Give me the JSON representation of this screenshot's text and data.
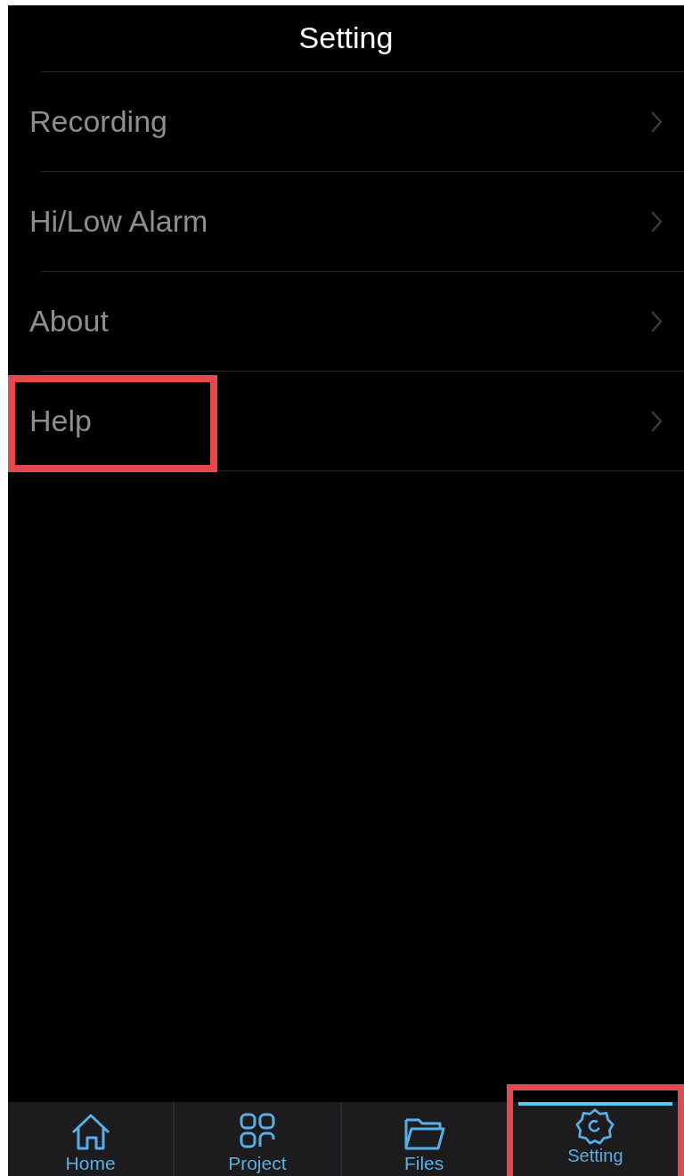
{
  "title": "Setting",
  "items": [
    {
      "label": "Recording",
      "highlighted": false
    },
    {
      "label": "Hi/Low Alarm",
      "highlighted": false
    },
    {
      "label": "About",
      "highlighted": false
    },
    {
      "label": "Help",
      "highlighted": true
    }
  ],
  "tabs": [
    {
      "label": "Home",
      "kind": "home",
      "selected": false,
      "highlighted": false
    },
    {
      "label": "Project",
      "kind": "grid",
      "selected": false,
      "highlighted": false
    },
    {
      "label": "Files",
      "kind": "folder",
      "selected": false,
      "highlighted": false
    },
    {
      "label": "Setting",
      "kind": "gear",
      "selected": true,
      "highlighted": true
    }
  ]
}
